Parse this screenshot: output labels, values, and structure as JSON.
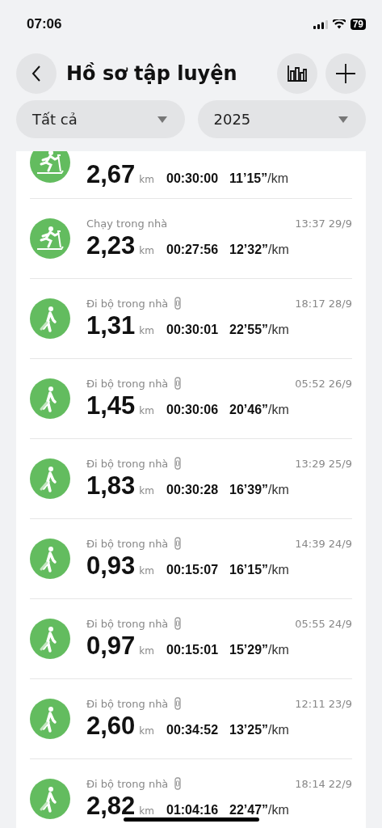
{
  "status_bar": {
    "time": "07:06",
    "battery": "79"
  },
  "header": {
    "title": "Hồ sơ tập luyện"
  },
  "filters": [
    {
      "label": "Tất cả"
    },
    {
      "label": "2025"
    }
  ],
  "workouts": [
    {
      "kind": "treadmill",
      "distance": "2,67",
      "unit": "km",
      "duration": "00:30:00",
      "pace": "11’15”",
      "pace_unit": "/km"
    },
    {
      "kind": "treadmill",
      "title": "Chạy trong nhà",
      "device": false,
      "time": "13:37 29/9",
      "distance": "2,23",
      "unit": "km",
      "duration": "00:27:56",
      "pace": "12’32”",
      "pace_unit": "/km"
    },
    {
      "kind": "walk",
      "title": "Đi bộ trong nhà",
      "device": true,
      "time": "18:17 28/9",
      "distance": "1,31",
      "unit": "km",
      "duration": "00:30:01",
      "pace": "22’55”",
      "pace_unit": "/km"
    },
    {
      "kind": "walk",
      "title": "Đi bộ trong nhà",
      "device": true,
      "time": "05:52 26/9",
      "distance": "1,45",
      "unit": "km",
      "duration": "00:30:06",
      "pace": "20’46”",
      "pace_unit": "/km"
    },
    {
      "kind": "walk",
      "title": "Đi bộ trong nhà",
      "device": true,
      "time": "13:29 25/9",
      "distance": "1,83",
      "unit": "km",
      "duration": "00:30:28",
      "pace": "16’39”",
      "pace_unit": "/km"
    },
    {
      "kind": "walk",
      "title": "Đi bộ trong nhà",
      "device": true,
      "time": "14:39 24/9",
      "distance": "0,93",
      "unit": "km",
      "duration": "00:15:07",
      "pace": "16’15”",
      "pace_unit": "/km"
    },
    {
      "kind": "walk",
      "title": "Đi bộ trong nhà",
      "device": true,
      "time": "05:55 24/9",
      "distance": "0,97",
      "unit": "km",
      "duration": "00:15:01",
      "pace": "15’29”",
      "pace_unit": "/km"
    },
    {
      "kind": "walk",
      "title": "Đi bộ trong nhà",
      "device": true,
      "time": "12:11 23/9",
      "distance": "2,60",
      "unit": "km",
      "duration": "00:34:52",
      "pace": "13’25”",
      "pace_unit": "/km"
    },
    {
      "kind": "walk",
      "title": "Đi bộ trong nhà",
      "device": true,
      "time": "18:14 22/9",
      "distance": "2,82",
      "unit": "km",
      "duration": "01:04:16",
      "pace": "22’47”",
      "pace_unit": "/km"
    }
  ]
}
